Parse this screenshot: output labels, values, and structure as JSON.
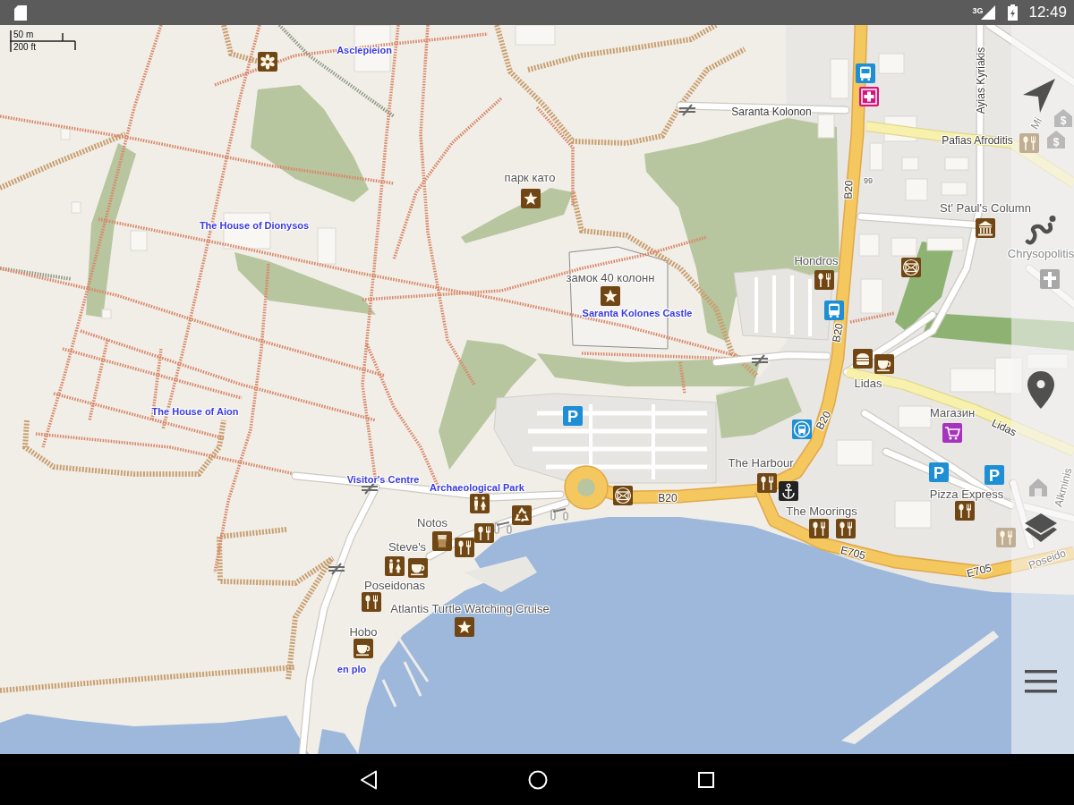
{
  "status_bar": {
    "network": "3G",
    "time": "12:49"
  },
  "map": {
    "scale_bar": {
      "metric": "50 m",
      "imperial": "200 ft"
    },
    "place_labels": [
      "Asclepieion",
      "The House of Dionysos",
      "Saranta Kolones Castle",
      "The House of Aion",
      "Visitor's Centre",
      "Archaeological Park",
      "en plo"
    ],
    "poi_labels": [
      "парк като",
      "замок 40 колонн",
      "St' Paul's Column",
      "Chrysopolitis",
      "Hondros",
      "Lidas",
      "Магазин",
      "The Harbour",
      "The Moorings",
      "Pizza Express",
      "Notos",
      "Steve's",
      "Poseidonas",
      "Atlantis Turtle Watching Cruise",
      "Hobo"
    ],
    "road_labels": [
      "Saranta Kolonon",
      "Pafias Afroditis",
      "Ayias Kyriakis",
      "Mi",
      "B20",
      "B20",
      "B20",
      "B20",
      "Lidas",
      "E705",
      "E705",
      "Alkminis",
      "Poseido"
    ],
    "house_numbers": [
      "99"
    ],
    "parking_signs": [
      "P",
      "P",
      "P"
    ],
    "bank_signs": [
      "$",
      "$"
    ]
  }
}
